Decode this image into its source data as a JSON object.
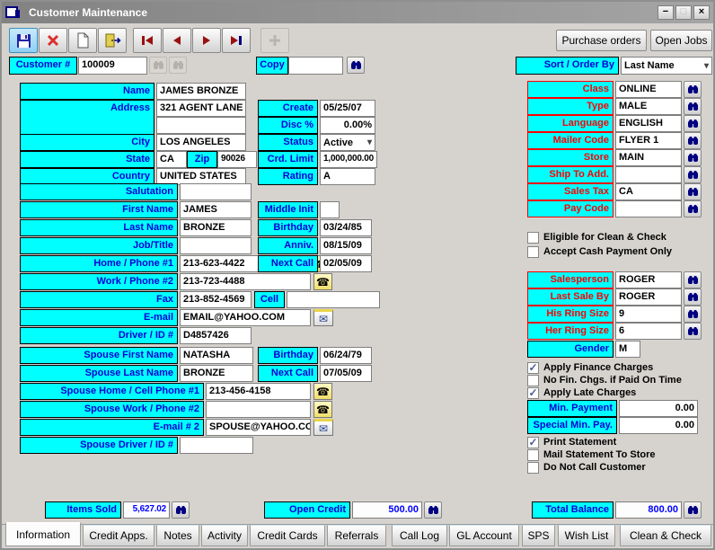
{
  "window": {
    "title": "Customer Maintenance"
  },
  "icons": {
    "minimize": "−",
    "maximize": "□",
    "close": "×",
    "dropdown_arrow": "▾",
    "check": "✓",
    "phone": "☎",
    "mail": "✉"
  },
  "toolbar": {
    "purchase_orders": "Purchase orders",
    "open_jobs": "Open Jobs"
  },
  "header": {
    "customer": {
      "label": "Customer #",
      "value": "100009"
    },
    "copy": {
      "label": "Copy",
      "value": ""
    },
    "sort": {
      "label": "Sort / Order By",
      "value": "Last Name"
    }
  },
  "g1": {
    "name": {
      "label": "Name",
      "value": "JAMES BRONZE"
    },
    "address": {
      "label": "Address",
      "value": "321 AGENT LANE",
      "value2": ""
    },
    "city": {
      "label": "City",
      "value": "LOS ANGELES"
    },
    "state": {
      "label": "State",
      "value": "CA"
    },
    "zip": {
      "label": "Zip",
      "value": "90026"
    },
    "country": {
      "label": "Country",
      "value": "UNITED STATES"
    }
  },
  "mid1": {
    "create": {
      "label": "Create",
      "value": "05/25/07"
    },
    "disc": {
      "label": "Disc %",
      "value": "0.00%"
    },
    "status": {
      "label": "Status",
      "value": "Active"
    },
    "crd_limit": {
      "label": "Crd. Limit",
      "value": "1,000,000.00"
    },
    "rating": {
      "label": "Rating",
      "value": "A"
    }
  },
  "g2": {
    "salutation": {
      "label": "Salutation",
      "value": ""
    },
    "first_name": {
      "label": "First Name",
      "value": "JAMES"
    },
    "last_name": {
      "label": "Last Name",
      "value": "BRONZE"
    },
    "job_title": {
      "label": "Job/Title",
      "value": ""
    },
    "home_phone": {
      "label": "Home / Phone #1",
      "value": "213-623-4422"
    },
    "work_phone": {
      "label": "Work / Phone #2",
      "value": "213-723-4488"
    },
    "fax": {
      "label": "Fax",
      "value": "213-852-4569"
    },
    "cell": {
      "label": "Cell",
      "value": ""
    },
    "email": {
      "label": "E-mail",
      "value": "EMAIL@YAHOO.COM"
    },
    "driver_id": {
      "label": "Driver / ID #",
      "value": "D4857426"
    }
  },
  "mid2": {
    "middle_init": {
      "label": "Middle Init",
      "value": ""
    },
    "birthday": {
      "label": "Birthday",
      "value": "03/24/85"
    },
    "anniv": {
      "label": "Anniv.",
      "value": "08/15/09"
    },
    "next_call": {
      "label": "Next Call",
      "value": "02/05/09"
    }
  },
  "g3": {
    "spouse_first": {
      "label": "Spouse First Name",
      "value": "NATASHA"
    },
    "spouse_last": {
      "label": "Spouse Last Name",
      "value": "BRONZE"
    },
    "birthday": {
      "label": "Birthday",
      "value": "06/24/79"
    },
    "next_call": {
      "label": "Next Call",
      "value": "07/05/09"
    },
    "spouse_home": {
      "label": "Spouse Home / Cell Phone #1",
      "value": "213-456-4158"
    },
    "spouse_work": {
      "label": "Spouse Work / Phone #2",
      "value": ""
    },
    "email2": {
      "label": "E-mail # 2",
      "value": "SPOUSE@YAHOO.COM"
    },
    "spouse_driver": {
      "label": "Spouse Driver / ID #",
      "value": ""
    }
  },
  "right": {
    "class": {
      "label": "Class",
      "value": "ONLINE"
    },
    "type": {
      "label": "Type",
      "value": "MALE"
    },
    "language": {
      "label": "Language",
      "value": "ENGLISH"
    },
    "mailer": {
      "label": "Mailer Code",
      "value": "FLYER 1"
    },
    "store": {
      "label": "Store",
      "value": "MAIN"
    },
    "ship_to": {
      "label": "Ship To Add.",
      "value": ""
    },
    "sales_tax": {
      "label": "Sales Tax",
      "value": "CA"
    },
    "pay_code": {
      "label": "Pay Code",
      "value": ""
    },
    "salesperson": {
      "label": "Salesperson",
      "value": "ROGER"
    },
    "last_sale_by": {
      "label": "Last Sale By",
      "value": "ROGER"
    },
    "his_ring": {
      "label": "His Ring Size",
      "value": "9"
    },
    "her_ring": {
      "label": "Her Ring Size",
      "value": "6"
    },
    "gender": {
      "label": "Gender",
      "value": "M"
    },
    "min_payment": {
      "label": "Min. Payment",
      "value": "0.00"
    },
    "special_min": {
      "label": "Special Min. Pay.",
      "value": "0.00"
    }
  },
  "checks": {
    "eligible": {
      "label": "Eligible for Clean & Check",
      "checked": false
    },
    "cash_only": {
      "label": "Accept Cash Payment Only",
      "checked": false
    },
    "finance": {
      "label": "Apply Finance Charges",
      "checked": true
    },
    "no_fin": {
      "label": "No Fin. Chgs. if Paid On Time",
      "checked": false
    },
    "late": {
      "label": "Apply Late Charges",
      "checked": true
    },
    "print": {
      "label": "Print Statement",
      "checked": true
    },
    "mail_store": {
      "label": "Mail Statement To Store",
      "checked": false
    },
    "no_call": {
      "label": "Do Not Call Customer",
      "checked": false
    }
  },
  "totals": {
    "items_sold": {
      "label": "Items Sold",
      "value": "5,627.02"
    },
    "open_credit": {
      "label": "Open Credit",
      "value": "500.00"
    },
    "total_balance": {
      "label": "Total Balance",
      "value": "800.00"
    }
  },
  "tabs": {
    "items": [
      "Information",
      "Credit Apps.",
      "Notes",
      "Activity",
      "Credit Cards",
      "Referrals",
      "Call Log",
      "GL Account",
      "SPS",
      "Wish List",
      "Clean & Check"
    ],
    "active": "Information"
  }
}
